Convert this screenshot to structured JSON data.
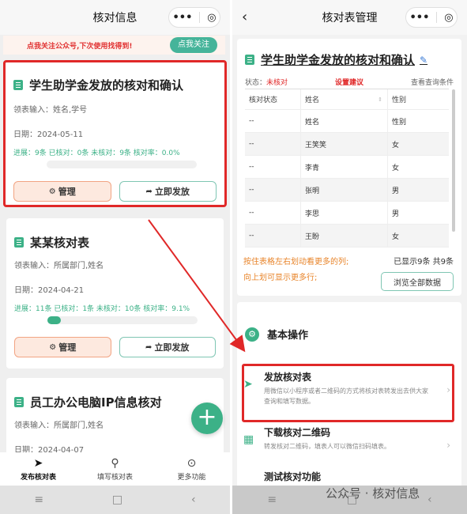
{
  "left": {
    "nav": {
      "title": "核对信息",
      "more": "•••",
      "target": "◎"
    },
    "banner": {
      "text": "点我关注公众号,下次使用找得到!",
      "button": "点我关注"
    },
    "cards": [
      {
        "title": "学生助学金发放的核对和确认",
        "fields": "领表输入：姓名,学号",
        "date": "日期：2024-05-11",
        "progress_label": "进展：",
        "progress_text": "9条 已核对：0条 未核对：9条 核对率：0.0%",
        "progress": 0.0,
        "manage": "管理",
        "send": "立即发放"
      },
      {
        "title": "某某核对表",
        "fields": "领表输入：所属部门,姓名",
        "date": "日期：2024-04-21",
        "progress_label": "进展：",
        "progress_text": "11条 已核对：1条 未核对：10条 核对率：9.1%",
        "progress": 0.091,
        "manage": "管理",
        "send": "立即发放"
      },
      {
        "title": "员工办公电脑IP信息核对",
        "fields": "领表输入：所属部门,姓名",
        "date": "日期：2024-04-07"
      }
    ],
    "fab": "+",
    "tabs": [
      {
        "label": "发布核对表",
        "icon": "send-icon"
      },
      {
        "label": "填写核对表",
        "icon": "search-icon"
      },
      {
        "label": "更多功能",
        "icon": "more-icon"
      }
    ]
  },
  "right": {
    "nav": {
      "back": "‹",
      "title": "核对表管理",
      "more": "•••",
      "target": "◎"
    },
    "title": "学生助学金发放的核对和确认",
    "status_label": "状态：",
    "status_value": "未核对",
    "set_advice": "设置建议",
    "query_cond": "查看查询条件",
    "table": {
      "headers": [
        "核对状态",
        "姓名",
        "性别"
      ],
      "rows": [
        [
          "--",
          "姓名",
          "性别"
        ],
        [
          "--",
          "王笑笑",
          "女"
        ],
        [
          "--",
          "李青",
          "女"
        ],
        [
          "--",
          "张明",
          "男"
        ],
        [
          "--",
          "李思",
          "男"
        ],
        [
          "--",
          "王盼",
          "女"
        ]
      ]
    },
    "hint1": "按住表格左右划动看更多的列;",
    "hint2": "向上划可显示更多行;",
    "count": "已显示9条 共9条",
    "browse": "浏览全部数据",
    "section": "基本操作",
    "ops": [
      {
        "title": "发放核对表",
        "desc": "用微信以小程序或者二维码的方式将核对表转发出去供大家查询和填写数据。",
        "icon": "send-icon"
      },
      {
        "title": "下载核对二维码",
        "desc": "转发核对二维码，填表人可以微信扫码填表。",
        "icon": "qrcode-icon"
      },
      {
        "title": "测试核对功能",
        "desc": "",
        "icon": "test-icon"
      }
    ],
    "watermark": "公众号 · 核对信息"
  },
  "sysnav": {
    "menu": "≡",
    "home": "□",
    "back": "‹"
  }
}
